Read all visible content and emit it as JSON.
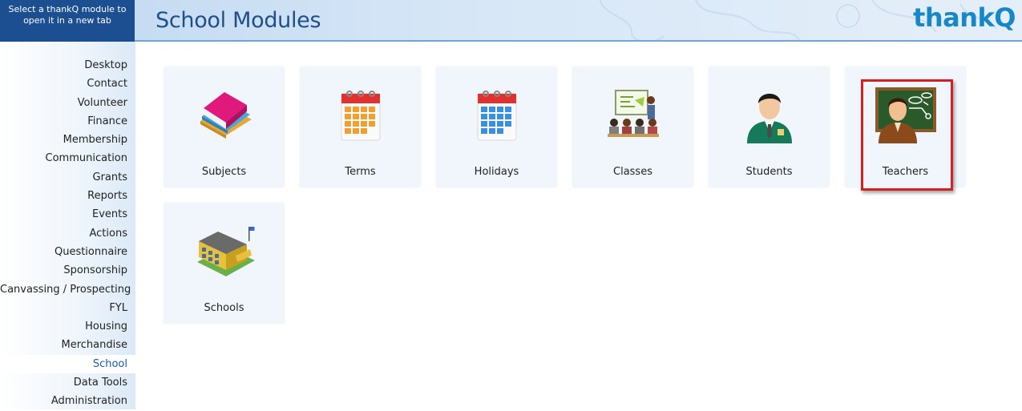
{
  "hint": {
    "line1": "Select a thankQ module to",
    "line2": "open it in a new tab"
  },
  "header": {
    "title": "School Modules",
    "brand": "thankQ"
  },
  "sidebar": {
    "items": [
      {
        "label": "Desktop"
      },
      {
        "label": "Contact"
      },
      {
        "label": "Volunteer"
      },
      {
        "label": "Finance"
      },
      {
        "label": "Membership"
      },
      {
        "label": "Communication"
      },
      {
        "label": "Grants"
      },
      {
        "label": "Reports"
      },
      {
        "label": "Events"
      },
      {
        "label": "Actions"
      },
      {
        "label": "Questionnaire"
      },
      {
        "label": "Sponsorship"
      },
      {
        "label": "Canvassing / Prospecting"
      },
      {
        "label": "FYL"
      },
      {
        "label": "Housing"
      },
      {
        "label": "Merchandise"
      },
      {
        "label": "School",
        "active": true
      },
      {
        "label": "Data Tools"
      },
      {
        "label": "Administration"
      }
    ]
  },
  "modules": [
    {
      "label": "Subjects",
      "icon": "books-icon"
    },
    {
      "label": "Terms",
      "icon": "calendar-orange-icon"
    },
    {
      "label": "Holidays",
      "icon": "calendar-blue-icon"
    },
    {
      "label": "Classes",
      "icon": "classroom-icon"
    },
    {
      "label": "Students",
      "icon": "student-icon"
    },
    {
      "label": "Teachers",
      "icon": "teacher-icon",
      "highlighted": true
    },
    {
      "label": "Schools",
      "icon": "school-building-icon"
    }
  ],
  "colors": {
    "brand_blue": "#1688c8",
    "title_blue": "#1e4f8c",
    "hint_bg": "#1c4f91",
    "tile_bg": "#f1f6fc",
    "highlight_red": "#d42020"
  }
}
